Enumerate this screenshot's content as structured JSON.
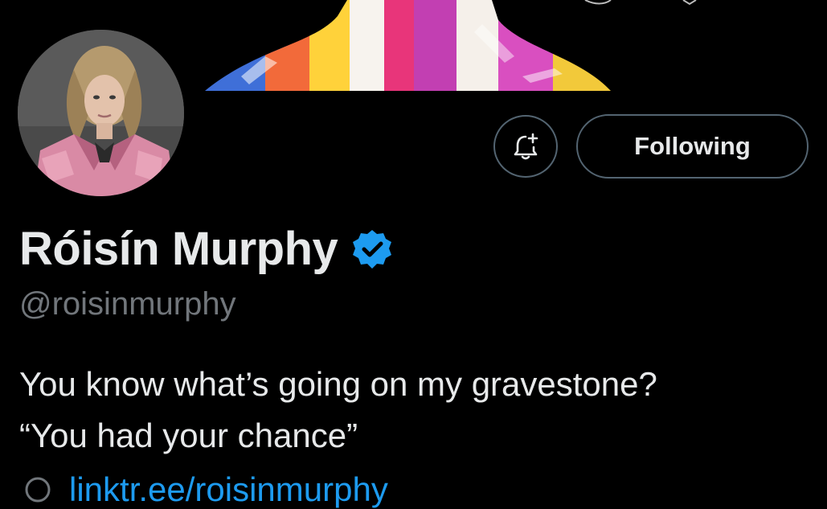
{
  "profile": {
    "display_name": "Róisín Murphy",
    "handle": "@roisinmurphy",
    "verified_icon": "verified-badge-icon",
    "avatar_icon": "profile-avatar",
    "banner_icon": "profile-banner",
    "bio_lines": [
      "You know what’s going on my gravestone?",
      "“You had your chance”"
    ],
    "link_text": "linktr.ee/roisinmurphy"
  },
  "actions": {
    "notify_icon": "bell-plus-icon",
    "following_label": "Following"
  },
  "colors": {
    "background": "#000000",
    "text_primary": "#e7e9ea",
    "text_secondary": "#71767b",
    "accent": "#1d9bf0",
    "button_border": "#536471"
  }
}
